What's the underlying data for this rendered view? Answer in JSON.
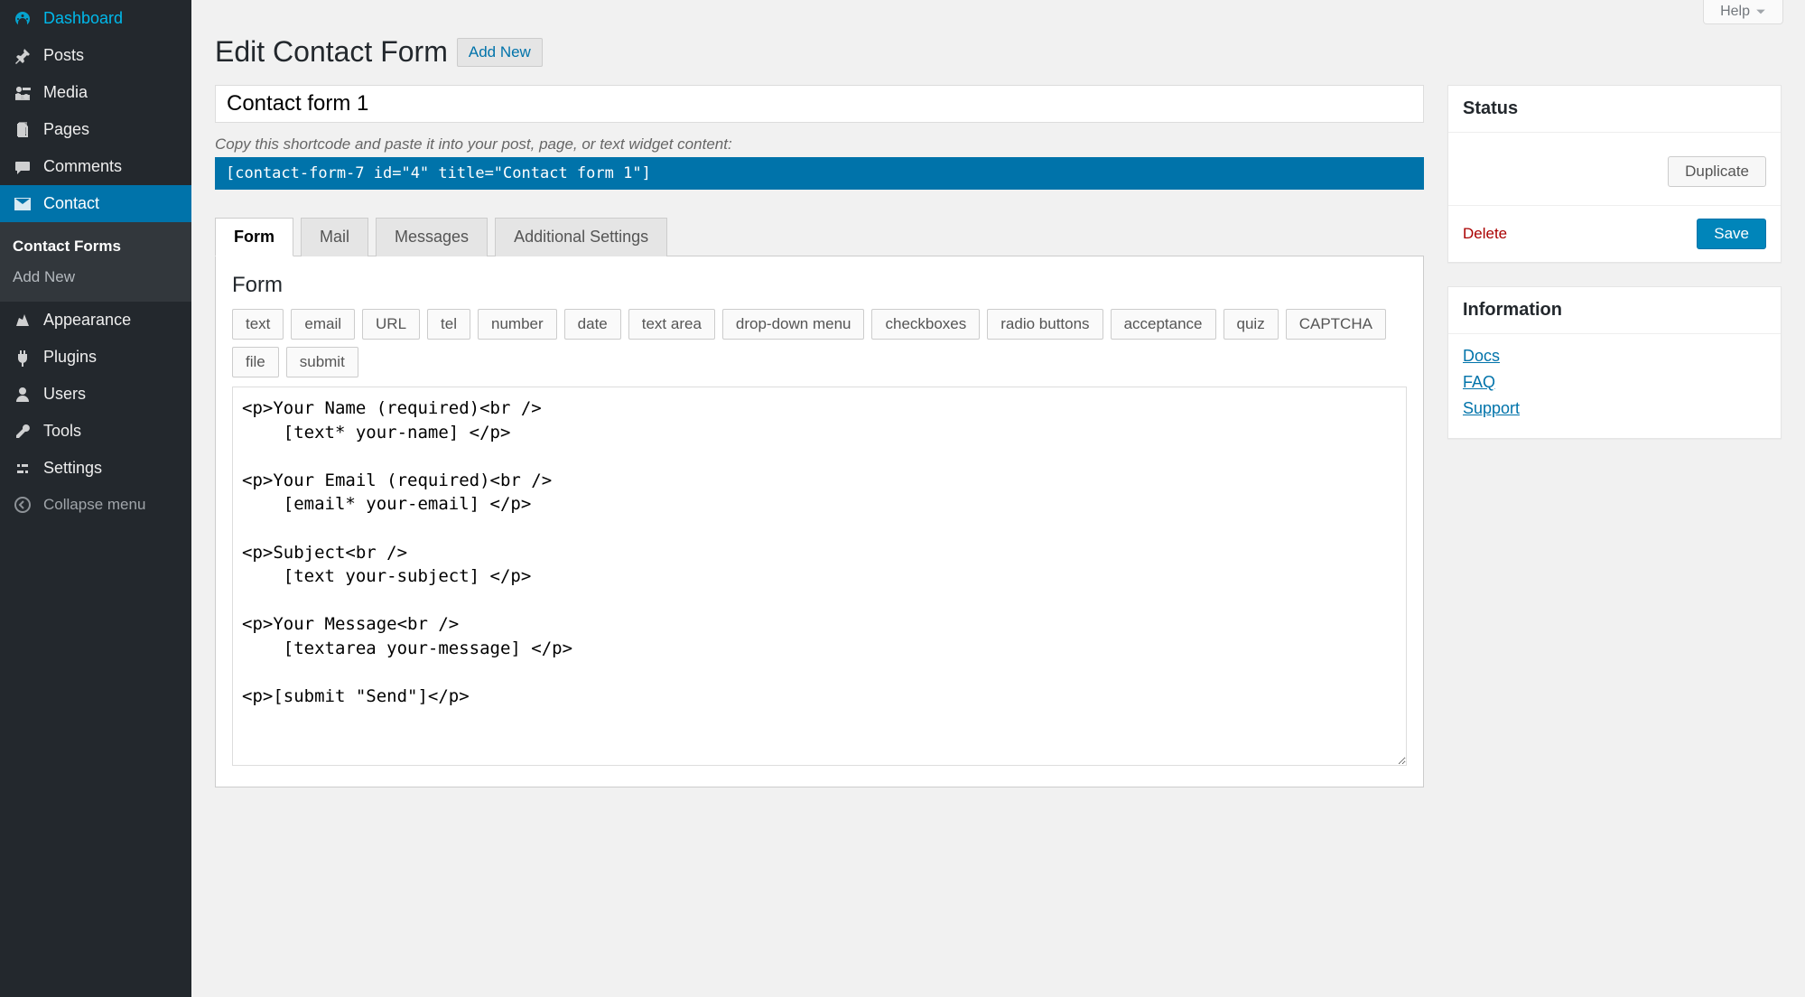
{
  "screenMeta": {
    "help": "Help"
  },
  "sidebar": {
    "items": [
      {
        "label": "Dashboard"
      },
      {
        "label": "Posts"
      },
      {
        "label": "Media"
      },
      {
        "label": "Pages"
      },
      {
        "label": "Comments"
      },
      {
        "label": "Contact"
      },
      {
        "label": "Appearance"
      },
      {
        "label": "Plugins"
      },
      {
        "label": "Users"
      },
      {
        "label": "Tools"
      },
      {
        "label": "Settings"
      }
    ],
    "sub": {
      "contactForms": "Contact Forms",
      "addNew": "Add New"
    },
    "collapse": "Collapse menu"
  },
  "header": {
    "title": "Edit Contact Form",
    "addNew": "Add New"
  },
  "form": {
    "titleValue": "Contact form 1",
    "shortcodeHint": "Copy this shortcode and paste it into your post, page, or text widget content:",
    "shortcode": "[contact-form-7 id=\"4\" title=\"Contact form 1\"]",
    "tabs": [
      "Form",
      "Mail",
      "Messages",
      "Additional Settings"
    ],
    "panelTitle": "Form",
    "tagButtons": [
      "text",
      "email",
      "URL",
      "tel",
      "number",
      "date",
      "text area",
      "drop-down menu",
      "checkboxes",
      "radio buttons",
      "acceptance",
      "quiz",
      "CAPTCHA",
      "file",
      "submit"
    ],
    "textarea": "<p>Your Name (required)<br />\n    [text* your-name] </p>\n\n<p>Your Email (required)<br />\n    [email* your-email] </p>\n\n<p>Subject<br />\n    [text your-subject] </p>\n\n<p>Your Message<br />\n    [textarea your-message] </p>\n\n<p>[submit \"Send\"]</p>"
  },
  "statusBox": {
    "title": "Status",
    "duplicate": "Duplicate",
    "delete": "Delete",
    "save": "Save"
  },
  "infoBox": {
    "title": "Information",
    "links": [
      "Docs",
      "FAQ",
      "Support"
    ]
  }
}
